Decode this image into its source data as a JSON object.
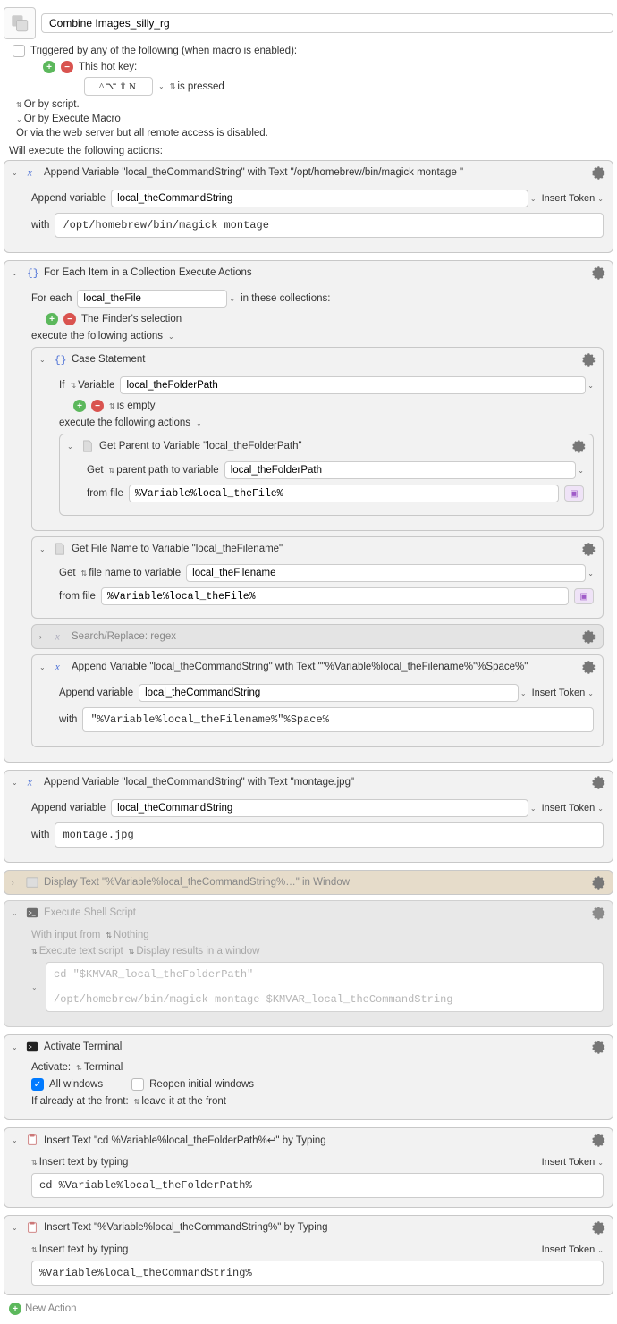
{
  "macro": {
    "title": "Combine Images_silly_rg"
  },
  "trigger": {
    "label": "Triggered by any of the following (when macro is enabled):",
    "hotkey_label": "This hot key:",
    "hotkey_value": "^⌥⇧N",
    "pressed_label": "is pressed",
    "or_script": "Or by script.",
    "or_exec": "Or by Execute Macro",
    "or_web": "Or via the web server but all remote access is disabled."
  },
  "exec_label": "Will execute the following actions:",
  "a1": {
    "title": "Append Variable \"local_theCommandString\" with Text \"/opt/homebrew/bin/magick montage \"",
    "append_label": "Append variable",
    "var": "local_theCommandString",
    "token": "Insert Token",
    "with_label": "with",
    "with_value": "/opt/homebrew/bin/magick montage "
  },
  "a2": {
    "title": "For Each Item in a Collection Execute Actions",
    "foreach_label": "For each",
    "var": "local_theFile",
    "in_label": "in these collections:",
    "finder_sel": "The Finder's selection",
    "exec_label": "execute the following actions"
  },
  "a2c": {
    "title": "Case Statement",
    "if_label": "If",
    "var_label": "Variable",
    "var": "local_theFolderPath",
    "empty_label": "is empty",
    "exec_label": "execute the following actions"
  },
  "a2c1": {
    "title": "Get Parent to Variable \"local_theFolderPath\"",
    "get_label": "Get",
    "path_label": "parent path to variable",
    "var": "local_theFolderPath",
    "from_label": "from file",
    "from_value": "%Variable%local_theFile%"
  },
  "a2f": {
    "title": "Get File Name to Variable \"local_theFilename\"",
    "get_label": "Get",
    "name_label": "file name to variable",
    "var": "local_theFilename",
    "from_label": "from file",
    "from_value": "%Variable%local_theFile%"
  },
  "a2s": {
    "title": "Search/Replace: regex"
  },
  "a2a": {
    "title": "Append Variable \"local_theCommandString\" with Text \"\"%Variable%local_theFilename%\"%Space%\"",
    "append_label": "Append variable",
    "var": "local_theCommandString",
    "token": "Insert Token",
    "with_label": "with",
    "with_value": "\"%Variable%local_theFilename%\"%Space%"
  },
  "a3": {
    "title": "Append Variable \"local_theCommandString\" with Text \"montage.jpg\"",
    "append_label": "Append variable",
    "var": "local_theCommandString",
    "token": "Insert Token",
    "with_label": "with",
    "with_value": "montage.jpg"
  },
  "a4": {
    "title": "Display Text \"%Variable%local_theCommandString%…\" in Window"
  },
  "a5": {
    "title": "Execute Shell Script",
    "input_label": "With input from",
    "nothing": "Nothing",
    "exec_opt": "Execute text script",
    "display_opt": "Display results in a window",
    "line1": "cd \"$KMVAR_local_theFolderPath\"",
    "line2": "/opt/homebrew/bin/magick montage $KMVAR_local_theCommandString"
  },
  "a6": {
    "title": "Activate Terminal",
    "activate_label": "Activate:",
    "terminal": "Terminal",
    "all_windows": "All windows",
    "reopen": "Reopen initial windows",
    "front_label": "If already at the front:",
    "leave": "leave it at the front"
  },
  "a7": {
    "title": "Insert Text \"cd %Variable%local_theFolderPath%↩\" by Typing",
    "insert_label": "Insert text by typing",
    "token": "Insert Token",
    "value": "cd %Variable%local_theFolderPath%"
  },
  "a8": {
    "title": "Insert Text \"%Variable%local_theCommandString%\" by Typing",
    "insert_label": "Insert text by typing",
    "token": "Insert Token",
    "value": "%Variable%local_theCommandString%"
  },
  "new_action": "New Action"
}
